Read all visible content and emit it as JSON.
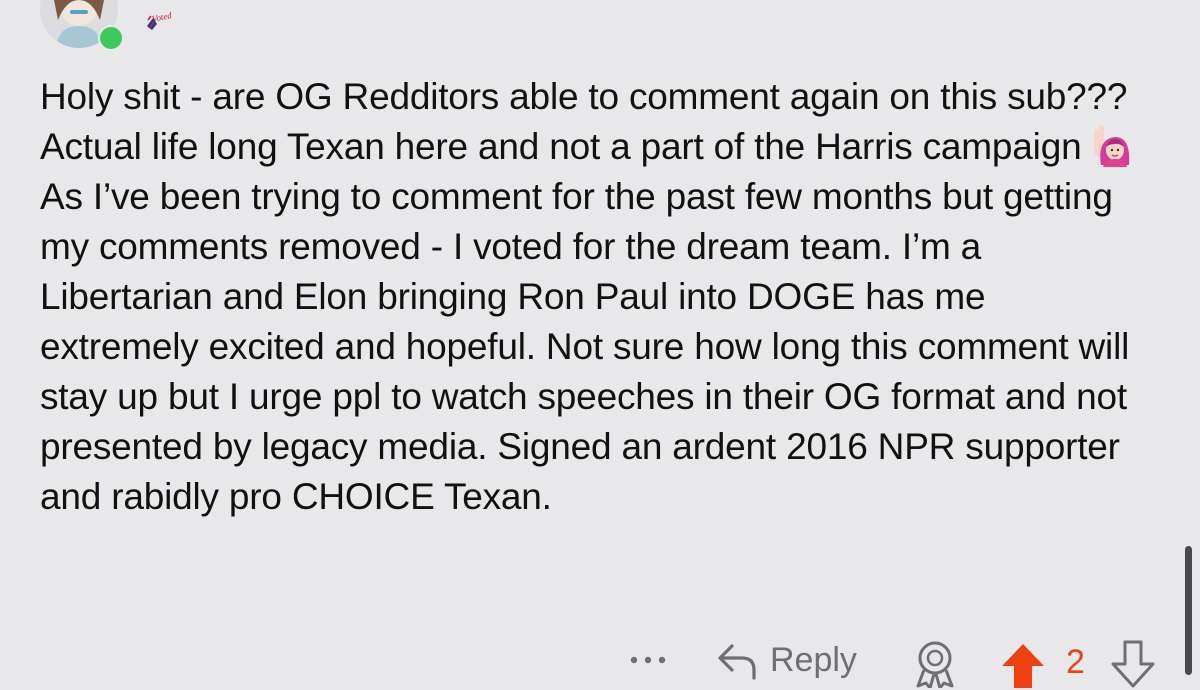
{
  "comment": {
    "flair_text": "Voted",
    "body_before_emoji": "Holy shit - are OG Redditors able to comment again on this sub??? Actual life long Texan here and not a part of the Harris campaign",
    "emoji_icon": "woman-raising-hand-emoji",
    "body_after_emoji": "As I’ve been trying to comment for the past few months but getting my comments removed - I voted for the dream team. I’m a Libertarian and Elon bringing Ron Paul into DOGE has me extremely excited and hopeful. Not sure how long this comment will stay up but I urge ppl to watch speeches in their OG format and not presented by legacy media. Signed an ardent 2016 NPR supporter and rabidly pro CHOICE Texan."
  },
  "actions": {
    "more_icon": "more-dots-icon",
    "reply_label": "Reply",
    "reply_icon": "reply-arrow-icon",
    "award_icon": "award-icon",
    "upvote_icon": "upvote-arrow-icon",
    "score": "2",
    "downvote_icon": "downvote-arrow-icon"
  },
  "colors": {
    "background": "#e8e8ea",
    "text": "#111111",
    "muted": "#6e6e73",
    "upvote": "#ee4011",
    "online": "#3fc95d"
  }
}
